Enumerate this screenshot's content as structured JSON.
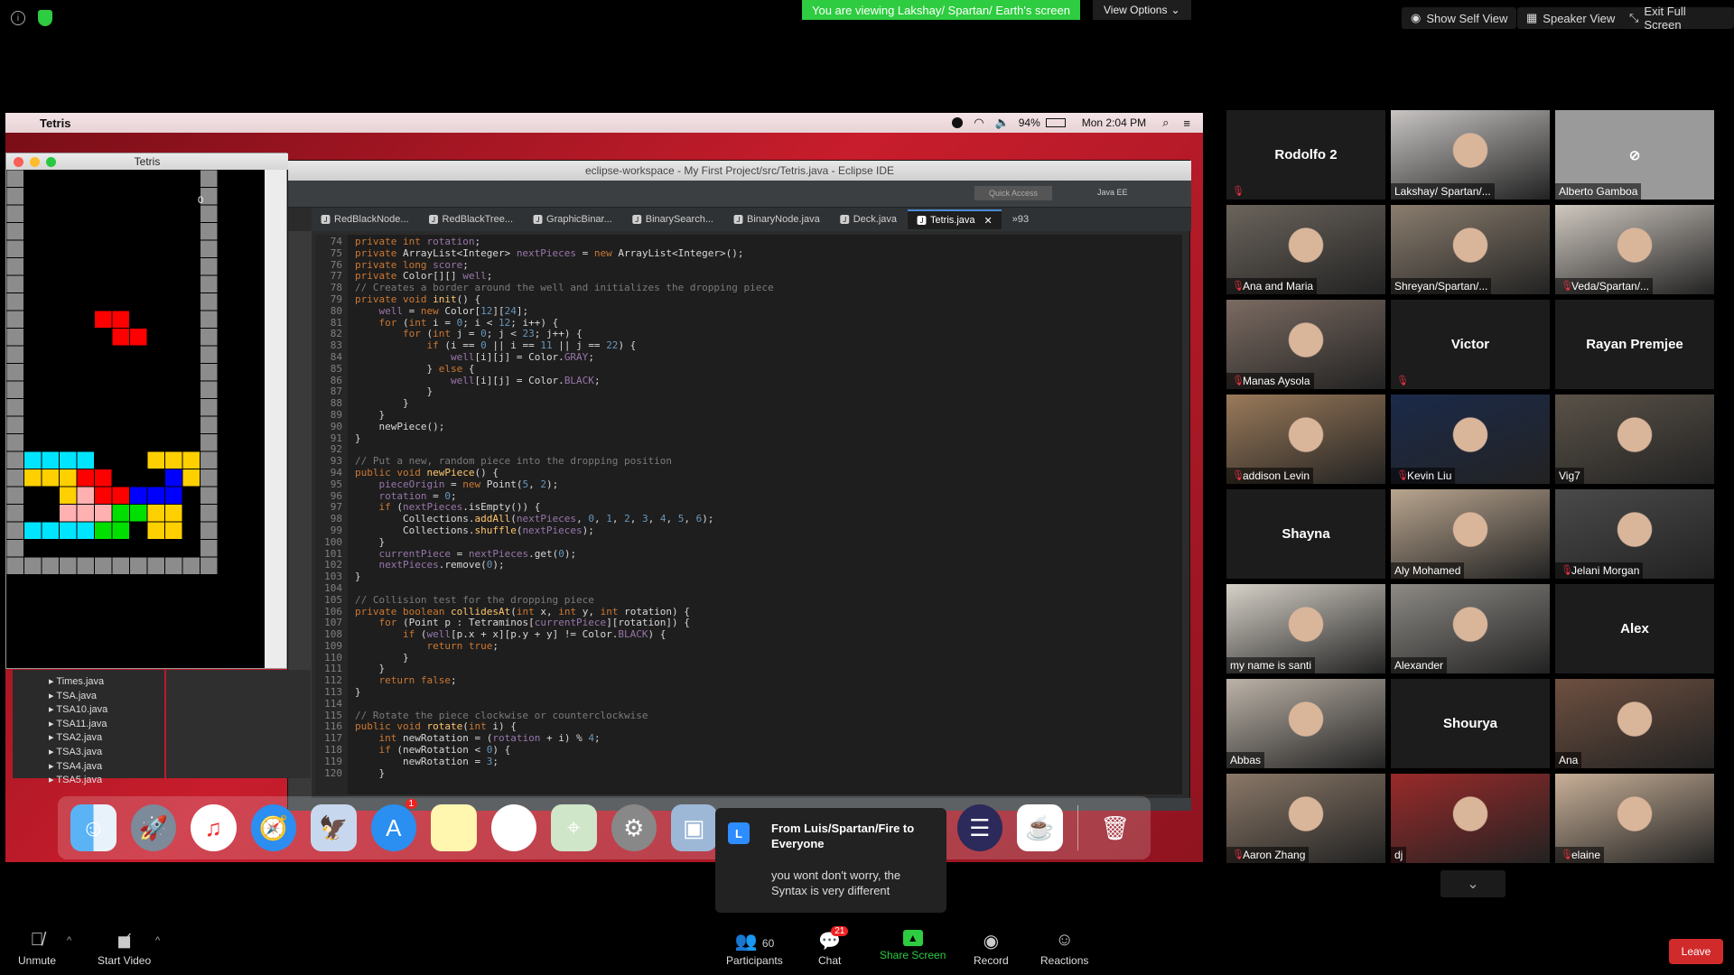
{
  "zoom": {
    "viewing_banner": "You are viewing Lakshay/ Spartan/ Earth's screen",
    "view_options": "View Options",
    "show_self_view": "Show Self View",
    "speaker_view": "Speaker View",
    "exit_full_screen": "Exit Full Screen"
  },
  "mac": {
    "app_name": "Tetris",
    "battery": "94%",
    "clock": "Mon 2:04 PM"
  },
  "tetris": {
    "window_title": "Tetris",
    "score": "0"
  },
  "eclipse": {
    "title": "eclipse-workspace - My First Project/src/Tetris.java - Eclipse IDE",
    "quick_access": "Quick Access",
    "perspective": "Java EE",
    "tabs": [
      "RedBlackNode...",
      "RedBlackTree...",
      "GraphicBinar...",
      "BinarySearch...",
      "BinaryNode.java",
      "Deck.java",
      "Tetris.java"
    ],
    "more_tabs": "»93",
    "packages": [
      "Times.java",
      "TSA.java",
      "TSA10.java",
      "TSA11.java",
      "TSA2.java",
      "TSA3.java",
      "TSA4.java",
      "TSA5.java"
    ],
    "line_numbers": [
      "74",
      "75",
      "76",
      "77",
      "78",
      "79",
      "80",
      "81",
      "82",
      "83",
      "84",
      "85",
      "86",
      "87",
      "88",
      "89",
      "90",
      "91",
      "92",
      "93",
      "94",
      "95",
      "96",
      "97",
      "98",
      "99",
      "100",
      "101",
      "102",
      "103",
      "104",
      "105",
      "106",
      "107",
      "108",
      "109",
      "110",
      "111",
      "112",
      "113",
      "114",
      "115",
      "116",
      "117",
      "118",
      "119",
      "120"
    ]
  },
  "dock": {
    "app_store_badge": "1"
  },
  "chat_popup": {
    "avatar_letter": "L",
    "from": "From Luis/Spartan/Fire to Everyone",
    "message": "you wont don't worry, the Syntax is very different"
  },
  "participants": [
    {
      "name": "Rodolfo 2",
      "mode": "name",
      "muted": true
    },
    {
      "name": "Lakshay/ Spartan/...",
      "mode": "video",
      "muted": false,
      "color": "#c7c4c2"
    },
    {
      "name": "Alberto Gamboa",
      "mode": "video-off",
      "muted": false
    },
    {
      "name": "Ana and Maria",
      "mode": "video",
      "muted": true,
      "color": "#6b645c"
    },
    {
      "name": "Shreyan/Spartan/...",
      "mode": "video",
      "muted": false,
      "color": "#8a7d6e"
    },
    {
      "name": "Veda/Spartan/...",
      "mode": "video",
      "muted": true,
      "color": "#cfc8c0"
    },
    {
      "name": "Manas Aysola",
      "mode": "video",
      "muted": true,
      "color": "#7b6b62"
    },
    {
      "name": "Victor",
      "mode": "name",
      "muted": true
    },
    {
      "name": "Rayan Premjee",
      "mode": "name",
      "muted": false
    },
    {
      "name": "addison Levin",
      "mode": "video",
      "muted": true,
      "color": "#9a7a5a"
    },
    {
      "name": "Kevin Liu",
      "mode": "video",
      "muted": true,
      "color": "#1b2a4a"
    },
    {
      "name": "Vig7",
      "mode": "video",
      "muted": false,
      "color": "#5a5248"
    },
    {
      "name": "Shayna",
      "mode": "name",
      "muted": false
    },
    {
      "name": "Aly Mohamed",
      "mode": "video",
      "muted": false,
      "color": "#b9a58f"
    },
    {
      "name": "Jelani Morgan",
      "mode": "video",
      "muted": true,
      "color": "#4a4a4a"
    },
    {
      "name": "my name is santi",
      "mode": "video",
      "muted": false,
      "color": "#d6d1c8",
      "active": true
    },
    {
      "name": "Alexander",
      "mode": "video",
      "muted": false,
      "color": "#8d8a85"
    },
    {
      "name": "Alex",
      "mode": "name",
      "muted": false
    },
    {
      "name": "Abbas",
      "mode": "video",
      "muted": false,
      "color": "#bcb3a8"
    },
    {
      "name": "Shourya",
      "mode": "name",
      "muted": false
    },
    {
      "name": "Ana",
      "mode": "video",
      "muted": false,
      "color": "#6e5040"
    },
    {
      "name": "Aaron Zhang",
      "mode": "video",
      "muted": true,
      "color": "#8a7868"
    },
    {
      "name": "dj",
      "mode": "video",
      "muted": false,
      "color": "#9a2a2a"
    },
    {
      "name": "elaine",
      "mode": "video",
      "muted": true,
      "color": "#c8b098"
    }
  ],
  "toolbar": {
    "unmute": "Unmute",
    "start_video": "Start Video",
    "participants_count": "60",
    "participants": "Participants",
    "chat_badge": "21",
    "chat": "Chat",
    "share_screen": "Share Screen",
    "record": "Record",
    "reactions": "Reactions",
    "leave": "Leave"
  },
  "colors": {
    "share_green": "#2ecc40",
    "leave_red": "#d12a2a",
    "active_speaker": "#d4f06a"
  }
}
